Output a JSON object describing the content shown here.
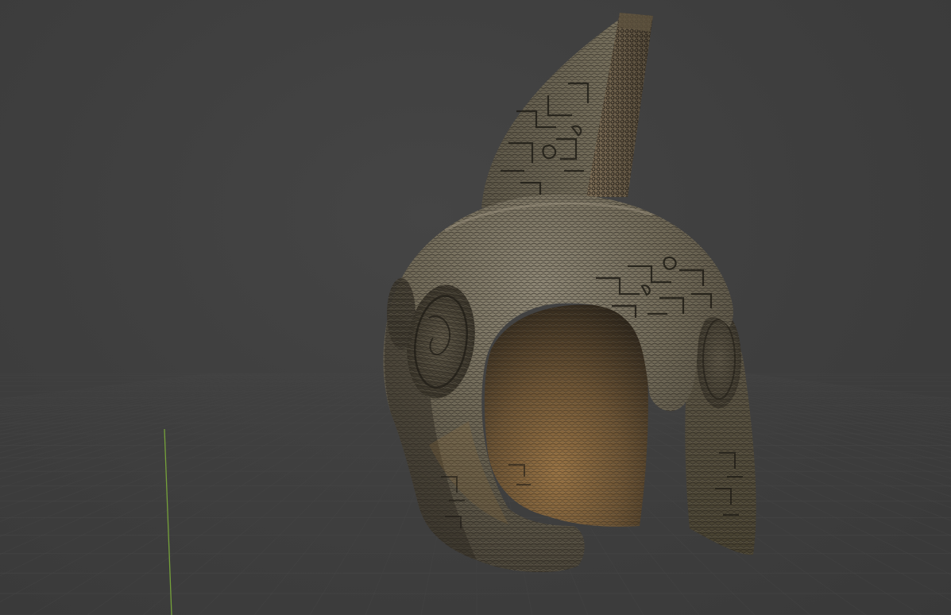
{
  "viewport": {
    "background": "#3d3d3d",
    "grid_line_color": "#474747",
    "y_axis_color": "#7fb33a",
    "view": "3d-perspective"
  },
  "scene": {
    "object": "helmet-model",
    "parts": [
      "dome",
      "crest",
      "left-cheek-guard",
      "right-cheek-guard",
      "face-opening",
      "engraved-medallions",
      "engraved-patterns"
    ],
    "material": "chainmail-scale-texture",
    "material_colors": {
      "base": "#6a6352",
      "highlight": "#8d8574",
      "shadow": "#2c2821",
      "interior_warm": "#8a6a3d"
    }
  }
}
